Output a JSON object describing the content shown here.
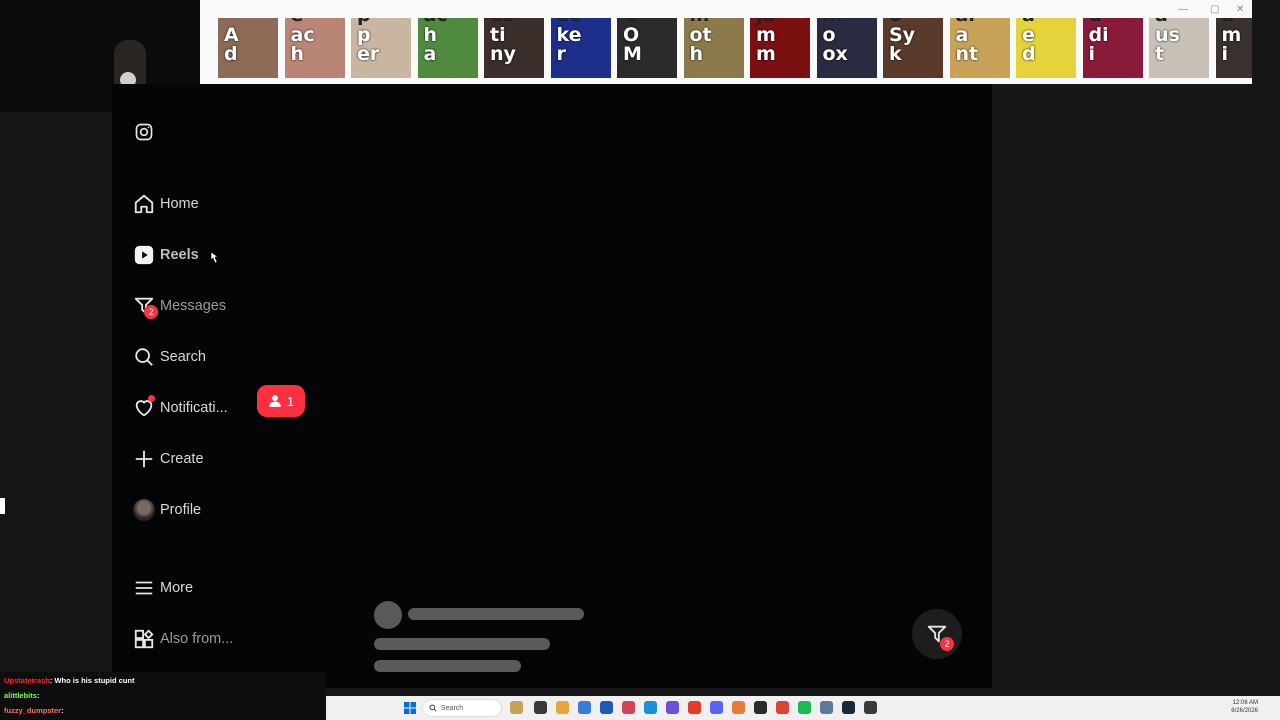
{
  "emotes": [
    {
      "cap": "",
      "label": "A\nd"
    },
    {
      "cap": "e",
      "label": "ac\nh"
    },
    {
      "cap": "p",
      "label": "p\ner"
    },
    {
      "cap": "ac",
      "label": "h\na"
    },
    {
      "cap": "es",
      "label": "ti\nny"
    },
    {
      "cap": "ec",
      "label": "ke\nr"
    },
    {
      "cap": "C",
      "label": "O\nM"
    },
    {
      "cap": "m",
      "label": "ot\nh"
    },
    {
      "cap": "ja",
      "label": "m\nm"
    },
    {
      "cap": "m",
      "label": "o\nox"
    },
    {
      "cap": "o",
      "label": "Sy\nk"
    },
    {
      "cap": "al",
      "label": "a\nnt"
    },
    {
      "cap": "a",
      "label": "e\nd"
    },
    {
      "cap": "u",
      "label": "di\ni"
    },
    {
      "cap": "a",
      "label": "us\nt"
    },
    {
      "cap": "a",
      "label": "m\ni"
    }
  ],
  "emote_colors": [
    "#8c6a55",
    "#b98676",
    "#c9b6a0",
    "#4f8a3f",
    "#3a2f2a",
    "#1c2f8a",
    "#2b2b2b",
    "#8c7a4a",
    "#7a1010",
    "#2a2a40",
    "#5a3a2a",
    "#c9a25a",
    "#e6d23a",
    "#8a1a3a",
    "#c9c0b8",
    "#3a3030"
  ],
  "nav": {
    "instagram_icon": "instagram-icon",
    "home": "Home",
    "reels": "Reels",
    "messages": "Messages",
    "messages_badge": "2",
    "search": "Search",
    "notifications": "Notificati...",
    "create": "Create",
    "profile": "Profile",
    "more": "More",
    "also_from": "Also from..."
  },
  "follow_popup": {
    "count": "1"
  },
  "messages_fab": {
    "badge": "2"
  },
  "chat": [
    {
      "user": "Upstatetrash",
      "text": ": Who is his stupid cunt"
    },
    {
      "user": "alittlebits",
      "text": ":"
    },
    {
      "user": "fuzzy_dumpster",
      "text": ":"
    }
  ],
  "taskbar": {
    "search_placeholder": "Search",
    "time": "12:06 AM",
    "date": "6/26/2026"
  },
  "colors": {
    "accent": "#ff3040",
    "page_bg": "#030507",
    "frame_bg": "#161616"
  }
}
